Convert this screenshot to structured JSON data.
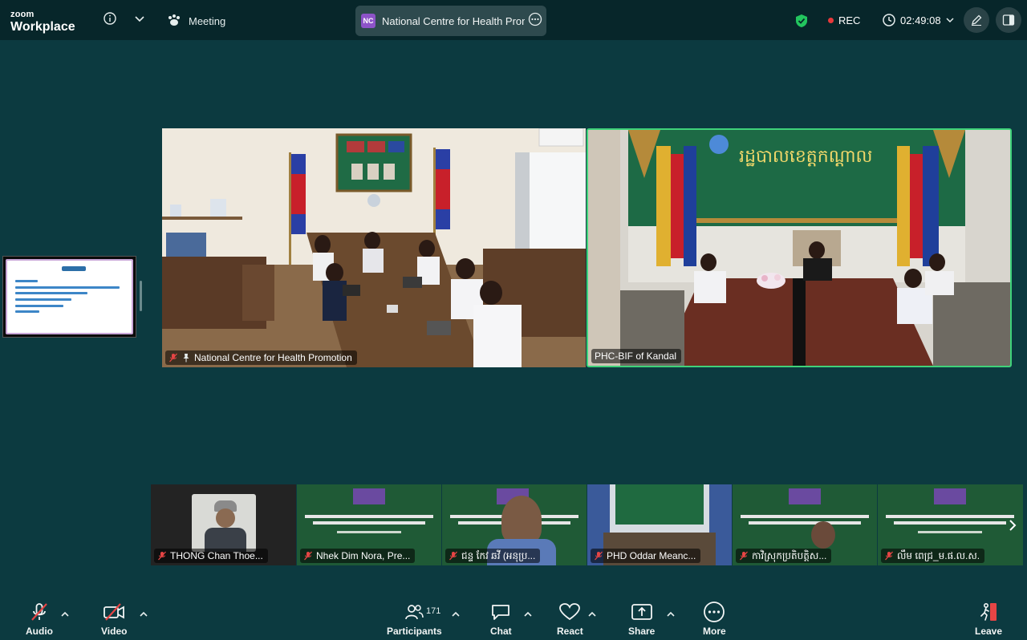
{
  "app": {
    "brand_top": "zoom",
    "brand_bottom": "Workplace"
  },
  "topbar": {
    "meeting_label": "Meeting",
    "title_initials": "NC",
    "meeting_title": "National Centre for Health Promotion",
    "rec_label": "REC",
    "timer": "02:49:08",
    "colors": {
      "shield": "#22c55e",
      "rec_dot": "#e8393b"
    }
  },
  "main_tiles": [
    {
      "name": "National Centre for Health Promotion",
      "pinned": true,
      "muted": true
    },
    {
      "name": "PHC-BIF of Kandal",
      "active_speaker": true,
      "muted": false
    }
  ],
  "shared_slide": {
    "title_visible": true
  },
  "thumbnails": [
    {
      "name": "THONG Chan Thoe..."
    },
    {
      "name": "Nhek Dim Nora, Pre..."
    },
    {
      "name": "ជន្ទ កែវ ឆវី (អនុប្រ..."
    },
    {
      "name": "PHD Oddar Meanc..."
    },
    {
      "name": "កាវិស្រុកប្រតិបត្តិស..."
    },
    {
      "name": "លឹម ពេជ្រ_ម.ផ.ល.ស."
    }
  ],
  "toolbar": {
    "audio": "Audio",
    "video": "Video",
    "participants": "Participants",
    "participants_count": "171",
    "chat": "Chat",
    "react": "React",
    "share": "Share",
    "more": "More",
    "leave": "Leave"
  }
}
